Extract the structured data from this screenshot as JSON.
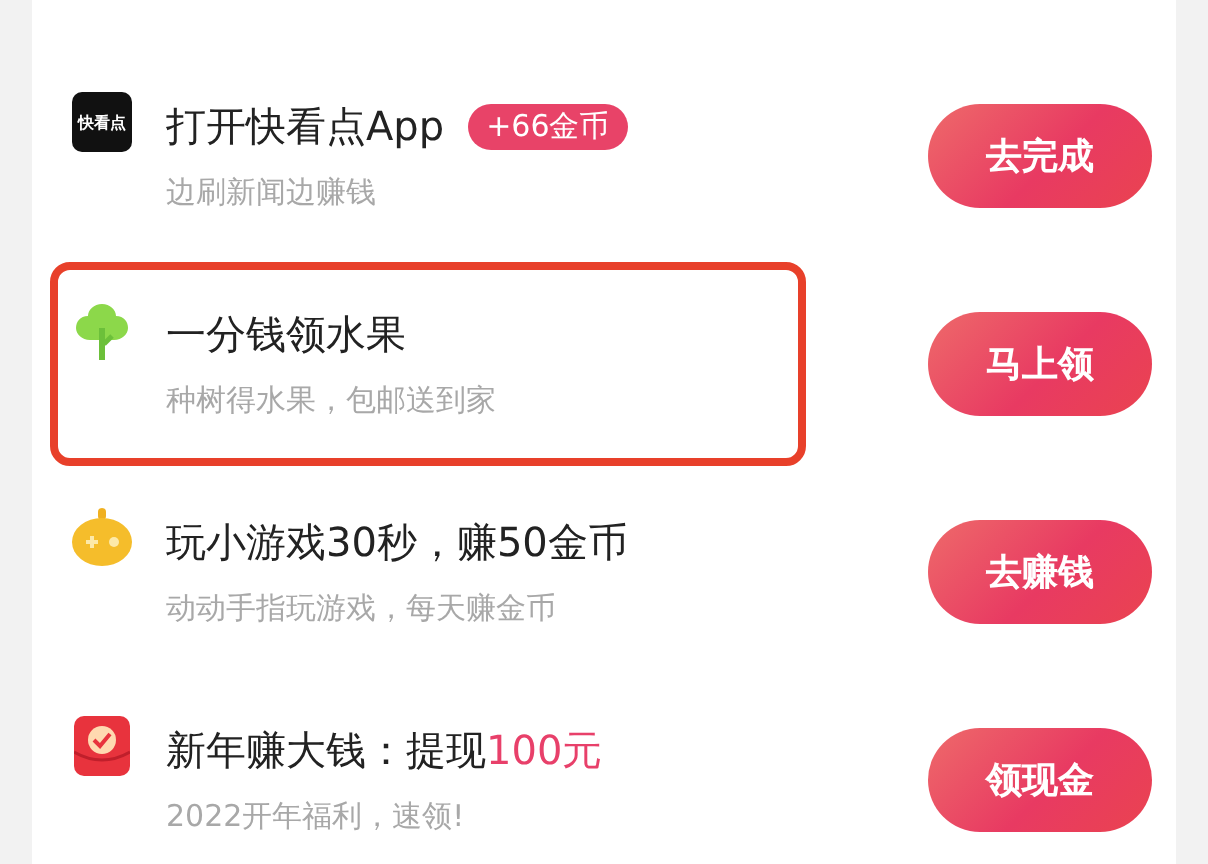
{
  "tasks": [
    {
      "kind": "logo",
      "icon_text": "快看点",
      "title": "打开快看点App",
      "badge": "+66金币",
      "subtitle": "边刷新闻边赚钱",
      "button": "去完成",
      "highlighted": false
    },
    {
      "kind": "tree",
      "title": "一分钱领水果",
      "subtitle": "种树得水果，包邮送到家",
      "button": "马上领",
      "highlighted": true
    },
    {
      "kind": "game",
      "title": "玩小游戏30秒，赚50金币",
      "subtitle": "动动手指玩游戏，每天赚金币",
      "button": "去赚钱",
      "highlighted": false
    },
    {
      "kind": "packet",
      "title": "新年赚大钱：提现",
      "title_accent": "100元",
      "subtitle": "2022开年福利，速领!",
      "button": "领现金",
      "highlighted": false
    }
  ]
}
